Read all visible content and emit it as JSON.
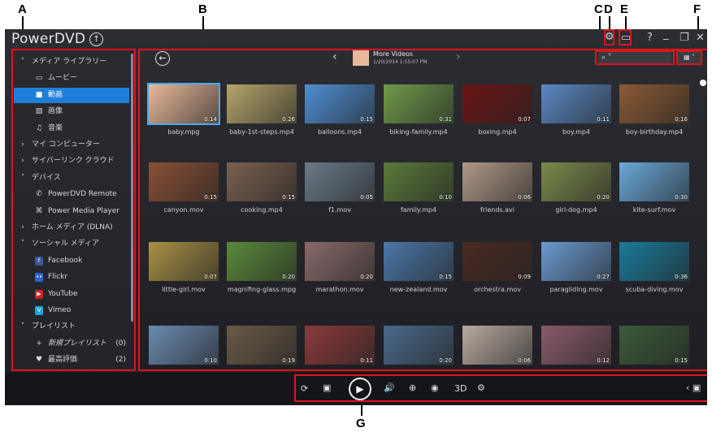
{
  "callouts": {
    "a": "A",
    "b": "B",
    "c": "C",
    "d": "D",
    "e": "E",
    "f": "F",
    "g": "G"
  },
  "app": {
    "title": "PowerDVD"
  },
  "titlebar": {
    "help": "?",
    "minimize": "_",
    "restore": "❐",
    "close": "✕"
  },
  "sidebar": {
    "items": [
      {
        "label": "メディア ライブラリー",
        "type": "section",
        "icon": "chevron-down"
      },
      {
        "label": "ムービー",
        "type": "child",
        "icon": "movie-icon"
      },
      {
        "label": "動画",
        "type": "child",
        "icon": "video-icon",
        "selected": true
      },
      {
        "label": "画像",
        "type": "child",
        "icon": "photo-icon"
      },
      {
        "label": "音楽",
        "type": "child",
        "icon": "music-icon"
      },
      {
        "label": "マイ コンピューター",
        "type": "section",
        "icon": "chevron-right"
      },
      {
        "label": "サイバーリンク クラウド",
        "type": "section",
        "icon": "chevron-right"
      },
      {
        "label": "デバイス",
        "type": "section",
        "icon": "chevron-down"
      },
      {
        "label": "PowerDVD Remote",
        "type": "child",
        "icon": "remote-icon"
      },
      {
        "label": "Power Media Player",
        "type": "child",
        "icon": "player-icon"
      },
      {
        "label": "ホーム メディア (DLNA)",
        "type": "section",
        "icon": "chevron-right"
      },
      {
        "label": "ソーシャル メディア",
        "type": "section",
        "icon": "chevron-down"
      },
      {
        "label": "Facebook",
        "type": "child",
        "icon": "facebook-icon"
      },
      {
        "label": "Flickr",
        "type": "child",
        "icon": "flickr-icon"
      },
      {
        "label": "YouTube",
        "type": "child",
        "icon": "youtube-icon"
      },
      {
        "label": "Vimeo",
        "type": "child",
        "icon": "vimeo-icon"
      },
      {
        "label": "プレイリスト",
        "type": "section",
        "icon": "chevron-down"
      },
      {
        "label": "新規プレイリスト",
        "type": "child",
        "icon": "plus-icon",
        "badge": "(0)"
      },
      {
        "label": "最高評価",
        "type": "child",
        "icon": "heart-icon",
        "badge": "(2)"
      }
    ]
  },
  "now_playing": {
    "title": "More Videos",
    "date": "1/20/2014 1:55:07 PM"
  },
  "grid": {
    "items": [
      {
        "name": "baby.mpg",
        "duration": "0:14",
        "color": "#e8b99a",
        "selected": true
      },
      {
        "name": "baby-1st-steps.mp4",
        "duration": "0:26",
        "color": "#b5a56a"
      },
      {
        "name": "balloons.mp4",
        "duration": "0:15",
        "color": "#4f8fd0"
      },
      {
        "name": "biking-family.mp4",
        "duration": "0:31",
        "color": "#6f9a4a"
      },
      {
        "name": "boxing.mp4",
        "duration": "0:07",
        "color": "#6a1616"
      },
      {
        "name": "boy.mp4",
        "duration": "0:11",
        "color": "#5a88c4"
      },
      {
        "name": "boy-birthday.mp4",
        "duration": "0:16",
        "color": "#8a5a34"
      },
      {
        "name": "canyon.mov",
        "duration": "0:15",
        "color": "#8a5036"
      },
      {
        "name": "cooking.mp4",
        "duration": "0:15",
        "color": "#7a6050"
      },
      {
        "name": "f1.mov",
        "duration": "0:05",
        "color": "#6a7a88"
      },
      {
        "name": "family.mp4",
        "duration": "0:10",
        "color": "#5c7a3a"
      },
      {
        "name": "friends.avi",
        "duration": "0:06",
        "color": "#b09888"
      },
      {
        "name": "girl-dog.mp4",
        "duration": "0:20",
        "color": "#7a8a4a"
      },
      {
        "name": "kite-surf.mov",
        "duration": "0:30",
        "color": "#6aa8d8"
      },
      {
        "name": "little-girl.mov",
        "duration": "0:07",
        "color": "#a89044"
      },
      {
        "name": "magnifing-glass.mpg",
        "duration": "0:20",
        "color": "#5a8a3a"
      },
      {
        "name": "marathon.mov",
        "duration": "0:20",
        "color": "#8a6a6a"
      },
      {
        "name": "new-zealand.mov",
        "duration": "0:15",
        "color": "#4a78a8"
      },
      {
        "name": "orchestra.mov",
        "duration": "0:09",
        "color": "#4a2a22"
      },
      {
        "name": "paragliding.mov",
        "duration": "0:27",
        "color": "#6a9ad0"
      },
      {
        "name": "scuba-diving.mov",
        "duration": "0:36",
        "color": "#1a7a9a"
      },
      {
        "name": "",
        "duration": "0:10",
        "color": "#6a8ab0"
      },
      {
        "name": "",
        "duration": "0:19",
        "color": "#6a5a48"
      },
      {
        "name": "",
        "duration": "0:11",
        "color": "#8a3a3a"
      },
      {
        "name": "",
        "duration": "0:20",
        "color": "#4a6a8a"
      },
      {
        "name": "",
        "duration": "0:06",
        "color": "#b8aaa0"
      },
      {
        "name": "",
        "duration": "0:12",
        "color": "#8a5a6a"
      },
      {
        "name": "",
        "duration": "0:15",
        "color": "#3a5a3a"
      }
    ]
  },
  "controls": {
    "three_d": "3D"
  },
  "colors": {
    "accent": "#1f7fd8",
    "callout_red": "#e0141c"
  }
}
